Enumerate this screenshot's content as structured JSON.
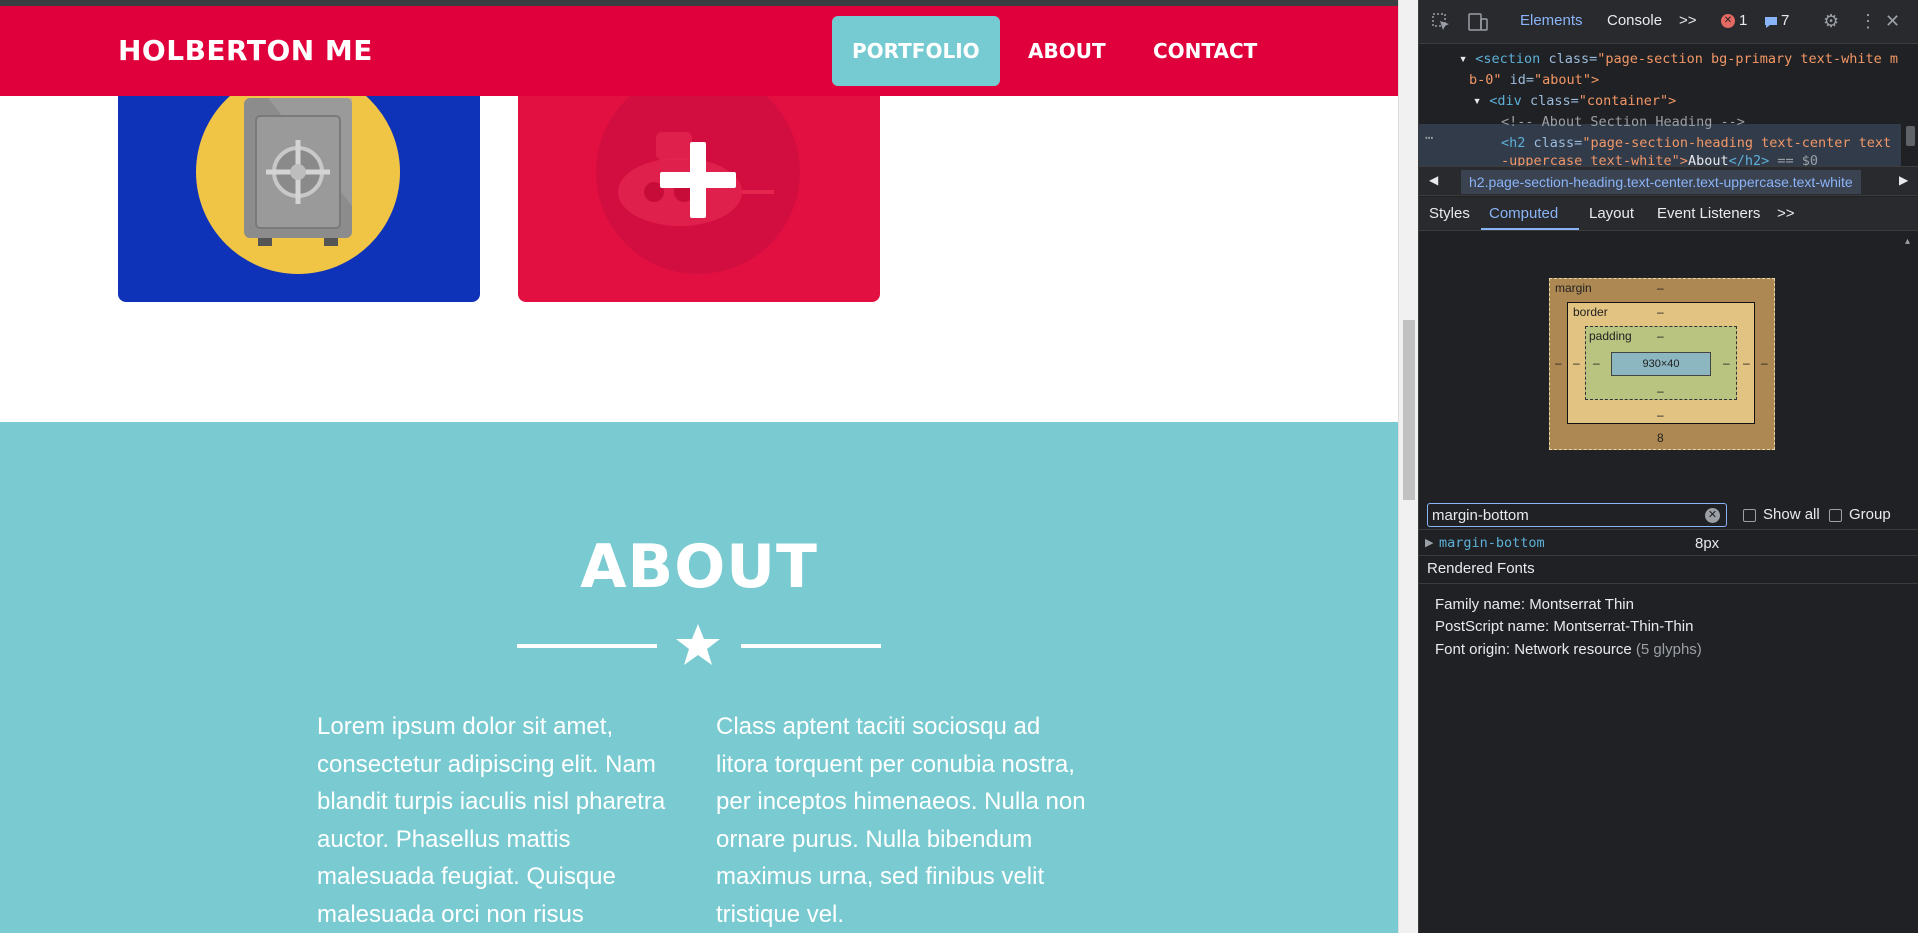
{
  "navbar": {
    "brand": "HOLBERTON ME",
    "links": [
      {
        "label": "PORTFOLIO",
        "active": true
      },
      {
        "label": "ABOUT",
        "active": false
      },
      {
        "label": "CONTACT",
        "active": false
      }
    ]
  },
  "portfolio": {
    "cards": [
      {
        "name": "safe",
        "color": "#0f33b8"
      },
      {
        "name": "submarine",
        "color": "#e11040"
      }
    ]
  },
  "about": {
    "title": "ABOUT",
    "col1": "Lorem ipsum dolor sit amet, consectetur adipiscing elit. Nam blandit turpis iaculis nisl pharetra auctor. Phasellus mattis malesuada feugiat. Quisque malesuada orci non risus",
    "col2": "Class aptent taciti sociosqu ad litora torquent per conubia nostra, per inceptos himenaeos. Nulla non ornare purus. Nulla bibendum maximus urna, sed finibus velit tristique vel."
  },
  "devtools": {
    "tabs": [
      "Elements",
      "Console"
    ],
    "active_tab": "Elements",
    "more": ">>",
    "error_count": "1",
    "message_count": "7",
    "dom": {
      "line1_tag": "<section",
      "line1_attr": "class=",
      "line1_val": "\"page-section bg-primary text-white m",
      "line2_val": "b-0\"",
      "line2_attr": "id=",
      "line2_val2": "\"about\">",
      "line3_tag": "<div",
      "line3_attr": "class=",
      "line3_val": "\"container\">",
      "line4_comment": "<!-- About Section Heading -->",
      "line5_tag": "<h2",
      "line5_attr": "class=",
      "line5_val": "\"page-section-heading text-center text",
      "line6_val": "-uppercase text-white\">",
      "line6_text": "About",
      "line6_close": "</h2>",
      "line6_eq": "== $0"
    },
    "breadcrumb": "h2.page-section-heading.text-center.text-uppercase.text-white",
    "subtabs": [
      "Styles",
      "Computed",
      "Layout",
      "Event Listeners",
      ">>"
    ],
    "active_subtab": "Computed",
    "box_model": {
      "margin_label": "margin",
      "border_label": "border",
      "padding_label": "padding",
      "content_size": "930×40",
      "dash": "–",
      "margin_bottom": "8"
    },
    "filter": {
      "value": "margin-bottom",
      "show_all": "Show all",
      "group": "Group"
    },
    "property": {
      "name": "margin-bottom",
      "value": "8px"
    },
    "rendered_fonts": {
      "title": "Rendered Fonts",
      "family": "Family name: Montserrat Thin",
      "postscript": "PostScript name: Montserrat-Thin-Thin",
      "origin": "Font origin: Network resource",
      "glyphs": "(5 glyphs)"
    }
  }
}
